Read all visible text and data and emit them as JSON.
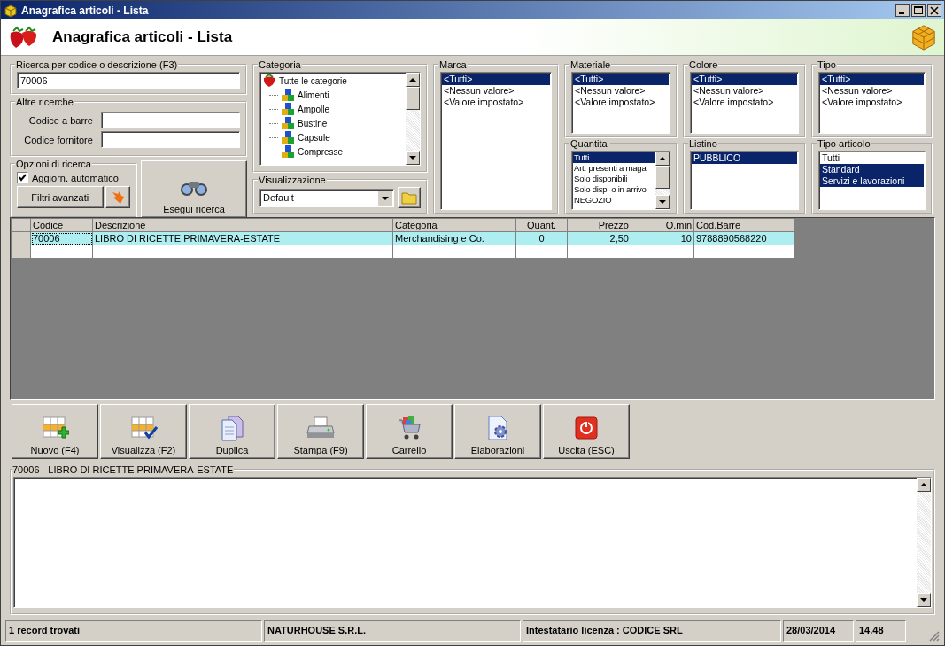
{
  "window": {
    "title": "Anagrafica articoli  - Lista"
  },
  "header": {
    "title": "Anagrafica articoli  - Lista"
  },
  "search": {
    "label": "Ricerca per codice o descrizione (F3)",
    "value": "70006"
  },
  "other_searches": {
    "label": "Altre ricerche",
    "fields": [
      {
        "label": "Codice a barre :"
      },
      {
        "label": "Codice fornitore :"
      }
    ]
  },
  "options": {
    "label": "Opzioni di ricerca",
    "auto_update": {
      "label": "Aggiorn. automatico",
      "checked": true
    },
    "advanced_filters": "Filtri avanzati"
  },
  "run_search": "Esegui ricerca",
  "category": {
    "label": "Categoria",
    "root": {
      "label": "Tutte le categorie",
      "children": [
        {
          "label": "Alimenti"
        },
        {
          "label": "Ampolle"
        },
        {
          "label": "Bustine"
        },
        {
          "label": "Capsule"
        },
        {
          "label": "Compresse"
        }
      ]
    }
  },
  "view": {
    "label": "Visualizzazione",
    "value": "Default"
  },
  "filters": [
    {
      "label": "Marca",
      "items": [
        {
          "label": "<Tutti>",
          "selected": true
        },
        {
          "label": "<Nessun valore>",
          "selected": false
        },
        {
          "label": "<Valore impostato>",
          "selected": false
        }
      ]
    },
    {
      "label": "Materiale",
      "items": [
        {
          "label": "<Tutti>",
          "selected": true
        },
        {
          "label": "<Nessun valore>",
          "selected": false
        },
        {
          "label": "<Valore impostato>",
          "selected": false
        }
      ]
    },
    {
      "label": "Colore",
      "items": [
        {
          "label": "<Tutti>",
          "selected": true
        },
        {
          "label": "<Nessun valore>",
          "selected": false
        },
        {
          "label": "<Valore impostato>",
          "selected": false
        }
      ]
    },
    {
      "label": "Tipo",
      "items": [
        {
          "label": "<Tutti>",
          "selected": true
        },
        {
          "label": "<Nessun valore>",
          "selected": false
        },
        {
          "label": "<Valore impostato>",
          "selected": false
        }
      ]
    },
    {
      "label": "Quantita'",
      "items": [
        {
          "label": "Tutti",
          "selected": true
        },
        {
          "label": "Art. presenti a maga",
          "selected": false
        },
        {
          "label": "Solo disponibili",
          "selected": false
        },
        {
          "label": "Solo disp. o in arrivo",
          "selected": false
        },
        {
          "label": "NEGOZIO",
          "selected": false
        }
      ]
    },
    {
      "label": "Listino",
      "items": [
        {
          "label": "PUBBLICO",
          "selected": true
        }
      ]
    },
    {
      "label": "Tipo articolo",
      "items": [
        {
          "label": "Tutti",
          "selected": false
        },
        {
          "label": "Standard",
          "selected": true
        },
        {
          "label": "Servizi e lavorazioni",
          "selected": true
        }
      ]
    }
  ],
  "table": {
    "columns": [
      "Codice",
      "Descrizione",
      "Categoria",
      "Quant.",
      "Prezzo",
      "Q.min",
      "Cod.Barre"
    ],
    "rows": [
      {
        "selected": true,
        "cells": [
          "70006",
          "LIBRO DI RICETTE PRIMAVERA-ESTATE",
          "Merchandising e Co.",
          "0",
          "2,50",
          "10",
          "9788890568220"
        ]
      }
    ]
  },
  "buttons": [
    {
      "kind": "new",
      "label": "Nuovo (F4)"
    },
    {
      "kind": "view",
      "label": "Visualizza (F2)"
    },
    {
      "kind": "duplicate",
      "label": "Duplica"
    },
    {
      "kind": "print",
      "label": "Stampa (F9)"
    },
    {
      "kind": "cart",
      "label": "Carrello"
    },
    {
      "kind": "process",
      "label": "Elaborazioni"
    },
    {
      "kind": "exit",
      "label": "Uscita (ESC)"
    }
  ],
  "memo": {
    "label": "70006 - LIBRO DI RICETTE PRIMAVERA-ESTATE"
  },
  "status_bar": [
    "1 record trovati",
    "NATURHOUSE S.R.L.",
    "Intestatario licenza : CODICE SRL",
    "28/03/2014",
    "14.48"
  ]
}
